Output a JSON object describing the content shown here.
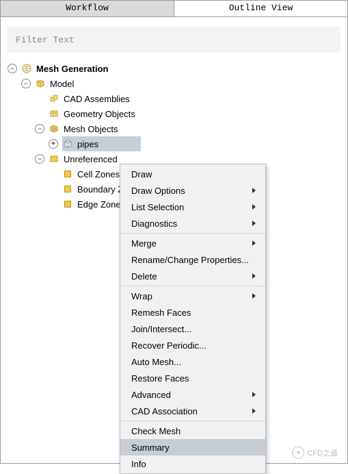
{
  "tabs": {
    "workflow": "Workflow",
    "outline": "Outline View"
  },
  "filter": {
    "placeholder": "Filter Text"
  },
  "tree": {
    "root": "Mesh Generation",
    "model": "Model",
    "cad": "CAD Assemblies",
    "geom": "Geometry Objects",
    "meshobj": "Mesh Objects",
    "pipes": "pipes",
    "unref": "Unreferenced",
    "cellz": "Cell Zones",
    "boundz": "Boundary Zones",
    "edgez": "Edge Zones"
  },
  "menu": {
    "draw": "Draw",
    "drawopt": "Draw Options",
    "listsel": "List Selection",
    "diag": "Diagnostics",
    "merge": "Merge",
    "rename": "Rename/Change Properties...",
    "delete": "Delete",
    "wrap": "Wrap",
    "remesh": "Remesh Faces",
    "join": "Join/Intersect...",
    "recover": "Recover Periodic...",
    "automesh": "Auto Mesh...",
    "restore": "Restore Faces",
    "advanced": "Advanced",
    "cadassoc": "CAD Association",
    "check": "Check Mesh",
    "summary": "Summary",
    "info": "Info"
  },
  "watermark": "CFD之道"
}
